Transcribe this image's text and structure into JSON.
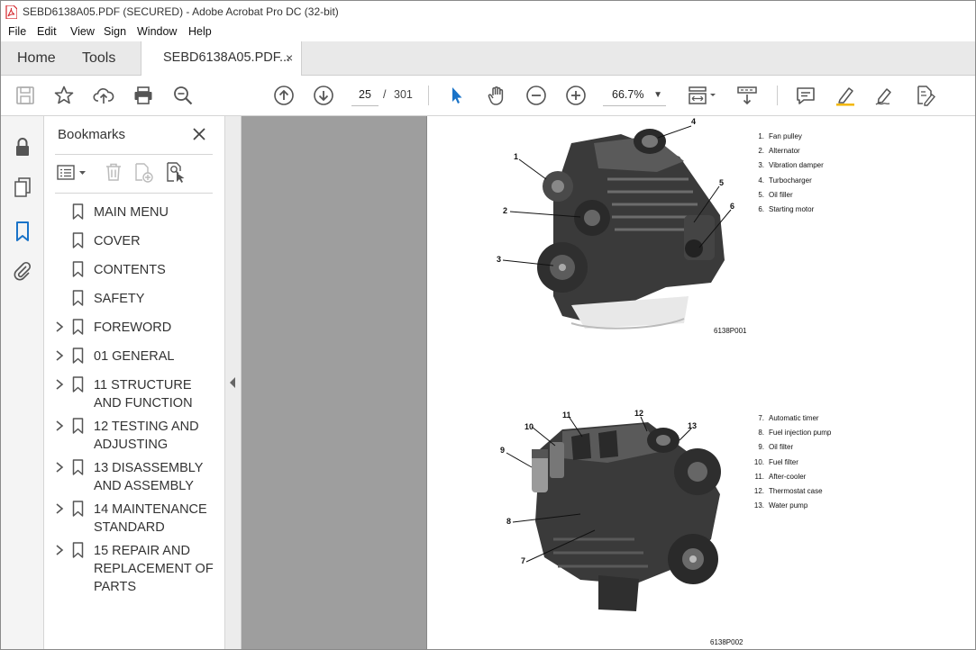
{
  "window": {
    "title": "SEBD6138A05.PDF (SECURED) - Adobe Acrobat Pro DC (32-bit)"
  },
  "menu": [
    "File",
    "Edit",
    "View",
    "Sign",
    "Window",
    "Help"
  ],
  "tabs": {
    "home": "Home",
    "tools": "Tools",
    "document": "SEBD6138A05.PDF...",
    "close": "×"
  },
  "toolbar": {
    "current_page": "25",
    "separator": "/",
    "total_pages": "301",
    "zoom": "66.7%"
  },
  "bookmarks": {
    "title": "Bookmarks",
    "items": [
      {
        "label": "MAIN MENU",
        "expandable": false
      },
      {
        "label": "COVER",
        "expandable": false
      },
      {
        "label": "CONTENTS",
        "expandable": false
      },
      {
        "label": "SAFETY",
        "expandable": false
      },
      {
        "label": "FOREWORD",
        "expandable": true
      },
      {
        "label": "01 GENERAL",
        "expandable": true
      },
      {
        "label": "11 STRUCTURE AND FUNCTION",
        "expandable": true
      },
      {
        "label": "12 TESTING AND ADJUSTING",
        "expandable": true
      },
      {
        "label": "13 DISASSEMBLY AND ASSEMBLY",
        "expandable": true
      },
      {
        "label": "14 MAINTENANCE STANDARD",
        "expandable": true
      },
      {
        "label": "15 REPAIR AND REPLACEMENT OF PARTS",
        "expandable": true
      }
    ]
  },
  "page": {
    "figure1": {
      "caption": "6138P001",
      "callouts": [
        "1",
        "2",
        "3",
        "4",
        "5",
        "6"
      ],
      "legend": [
        {
          "num": "1.",
          "text": "Fan pulley"
        },
        {
          "num": "2.",
          "text": "Alternator"
        },
        {
          "num": "3.",
          "text": "Vibration damper"
        },
        {
          "num": "4.",
          "text": "Turbocharger"
        },
        {
          "num": "5.",
          "text": "Oil filler"
        },
        {
          "num": "6.",
          "text": "Starting motor"
        }
      ]
    },
    "figure2": {
      "caption": "6138P002",
      "callouts": [
        "7",
        "8",
        "9",
        "10",
        "11",
        "12",
        "13"
      ],
      "legend": [
        {
          "num": "7.",
          "text": "Automatic timer"
        },
        {
          "num": "8.",
          "text": "Fuel injection pump"
        },
        {
          "num": "9.",
          "text": "Oil filter"
        },
        {
          "num": "10.",
          "text": "Fuel filter"
        },
        {
          "num": "11.",
          "text": "After-cooler"
        },
        {
          "num": "12.",
          "text": "Thermostat case"
        },
        {
          "num": "13.",
          "text": "Water pump"
        }
      ]
    }
  },
  "colors": {
    "accent": "#1a73c8",
    "pdf_red": "#d4252b",
    "chrome": "#e9e9e9",
    "viewer_bg": "#9e9e9e"
  }
}
